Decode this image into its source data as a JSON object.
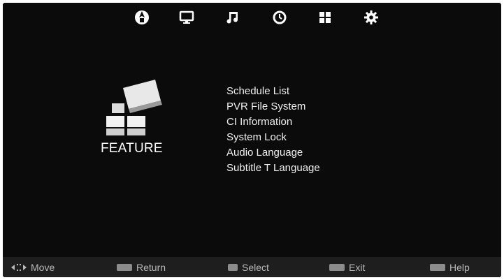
{
  "top_bar": {
    "icons": [
      {
        "name": "channel-icon",
        "active": true
      },
      {
        "name": "picture-icon",
        "active": false
      },
      {
        "name": "sound-icon",
        "active": false
      },
      {
        "name": "time-icon",
        "active": false
      },
      {
        "name": "feature-icon",
        "active": false
      },
      {
        "name": "setup-icon",
        "active": false
      }
    ]
  },
  "feature": {
    "title": "FEATURE",
    "icon": "feature-blocks-icon"
  },
  "menu": {
    "items": [
      "Schedule List",
      "PVR File System",
      "CI Information",
      "System Lock",
      "Audio Language",
      "Subtitle T Language"
    ]
  },
  "bottom_bar": {
    "move_label": "Move",
    "return_label": "Return",
    "select_label": "Select",
    "exit_label": "Exit",
    "help_label": "Help",
    "icons": [
      "move-arrows-icon",
      "menu-key-icon",
      "ok-key-icon",
      "exit-key-icon",
      "info-key-icon"
    ]
  },
  "colors": {
    "background": "#0b0b0b",
    "text": "#f0f0f0",
    "bottom_bar": "#1e1e1e",
    "hint_text": "#b9b9b9"
  }
}
